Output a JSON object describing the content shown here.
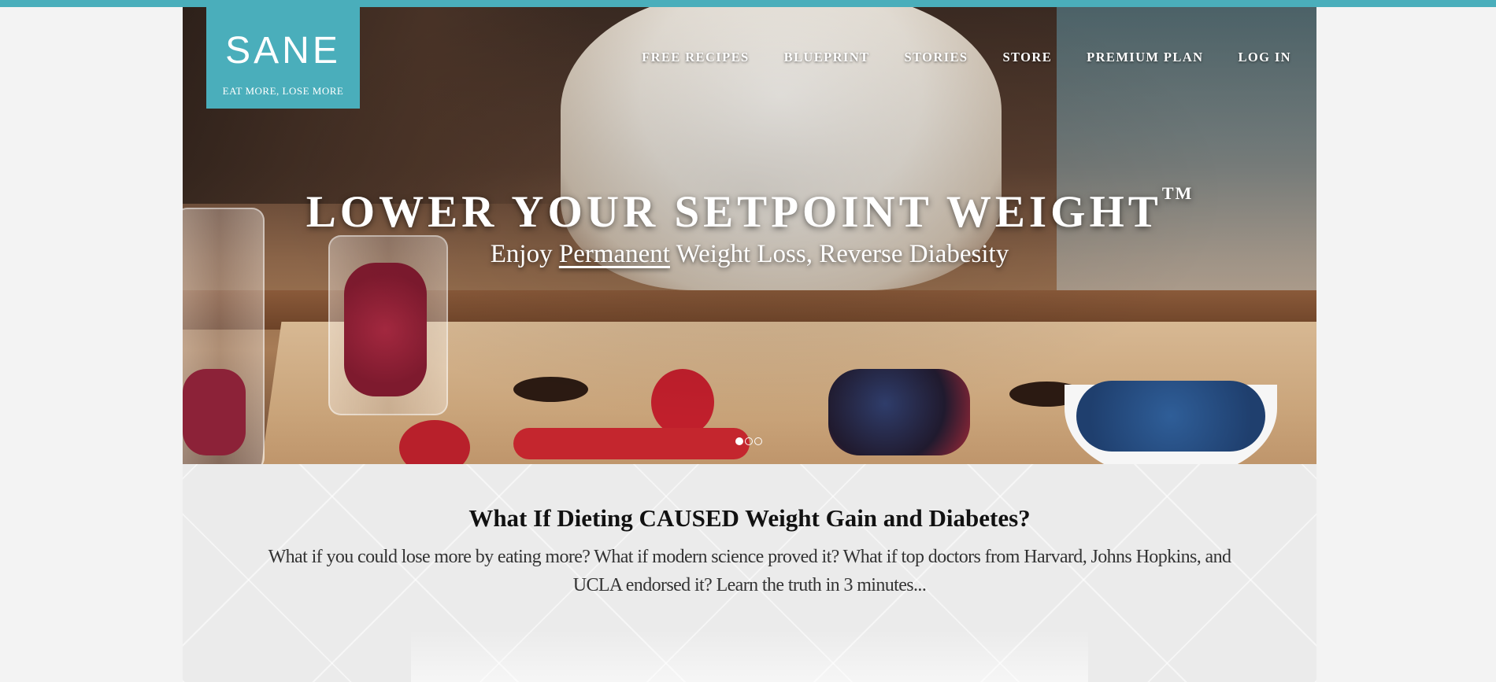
{
  "brand": {
    "name": "SANE",
    "tagline": "EAT MORE, LOSE MORE",
    "accent_color": "#4aaebb"
  },
  "nav": {
    "items": [
      {
        "label": "FREE RECIPES"
      },
      {
        "label": "BLUEPRINT"
      },
      {
        "label": "STORIES"
      },
      {
        "label": "STORE"
      },
      {
        "label": "PREMIUM PLAN"
      },
      {
        "label": "LOG IN"
      }
    ]
  },
  "hero": {
    "title": "LOWER YOUR SETPOINT WEIGHT",
    "title_mark": "TM",
    "subtitle_before": "Enjoy ",
    "subtitle_underlined": "Permanent",
    "subtitle_after": " Weight Loss, Reverse Diabesity",
    "slides": {
      "total": 3,
      "active": 1
    }
  },
  "intro": {
    "headline": "What If Dieting CAUSED Weight Gain and Diabetes?",
    "body": "What if you could lose more by eating more? What if modern science proved it? What if top doctors from Harvard, Johns Hopkins, and UCLA endorsed it? Learn the truth in 3 minutes..."
  }
}
